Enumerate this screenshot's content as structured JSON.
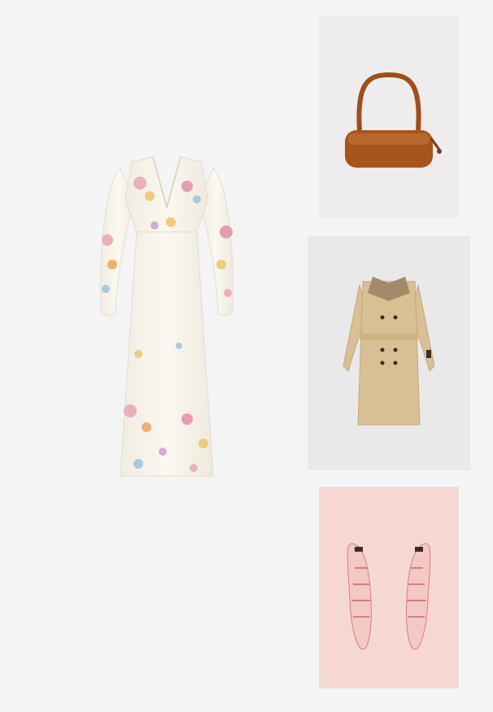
{
  "collage": {
    "background": "#f5f4f4",
    "items": [
      {
        "name": "floral-maxi-dress",
        "kind": "dress",
        "colors": [
          "#f7f1e6",
          "#e8a6b6",
          "#f0c36a",
          "#9cc3e0"
        ]
      },
      {
        "name": "brown-leather-shoulder-bag",
        "kind": "bag",
        "colors": [
          "#a6551f",
          "#c77338",
          "#eeecec"
        ]
      },
      {
        "name": "beige-trench-coat",
        "kind": "coat",
        "colors": [
          "#d8bf94",
          "#a58a6a",
          "#3b2e26",
          "#e9e9ea"
        ]
      },
      {
        "name": "pink-slingback-pumps",
        "kind": "shoes",
        "colors": [
          "#f2c9c3",
          "#d97b87",
          "#f6d8d2"
        ]
      }
    ]
  }
}
